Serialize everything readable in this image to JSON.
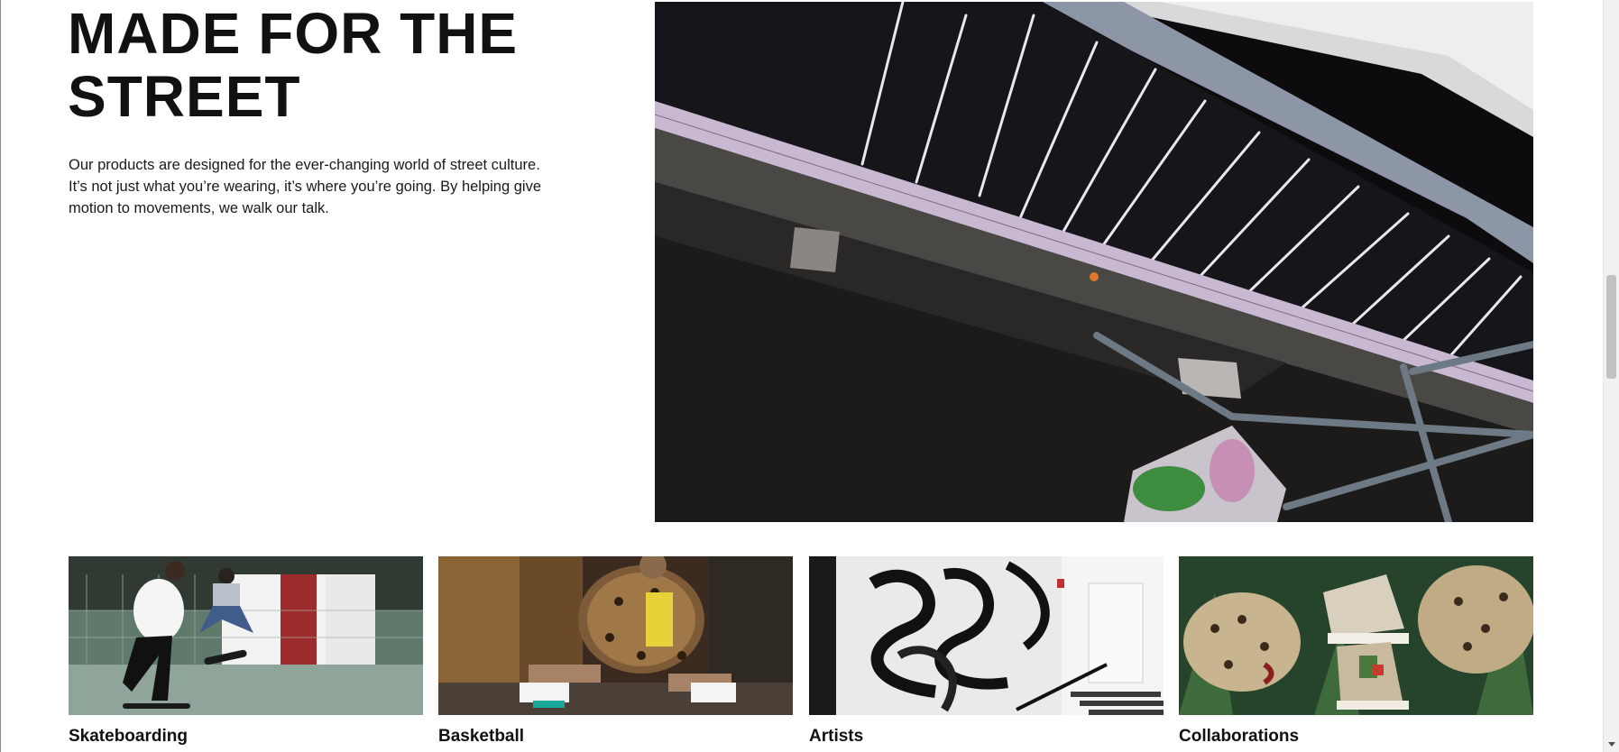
{
  "hero": {
    "title_line1": "MADE FOR THE",
    "title_line2": "STREET",
    "paragraph_line1": "Our products are designed for the ever-changing world of street culture.",
    "paragraph_line2": "It’s not just what you’re wearing, it’s where you’re going. By helping give",
    "paragraph_line3": "motion to movements, we walk our talk.",
    "image_icon": "street-overpass-photo"
  },
  "tiles": [
    {
      "label": "Skateboarding",
      "image_icon": "skateboarding-photo"
    },
    {
      "label": "Basketball",
      "image_icon": "basketball-photo"
    },
    {
      "label": "Artists",
      "image_icon": "graffiti-art-photo"
    },
    {
      "label": "Collaborations",
      "image_icon": "leopard-sneakers-photo"
    }
  ],
  "colors": {
    "text": "#111111",
    "background": "#ffffff",
    "scrollbar_track": "#f1f1f1",
    "scrollbar_thumb": "#c1c1c1"
  }
}
